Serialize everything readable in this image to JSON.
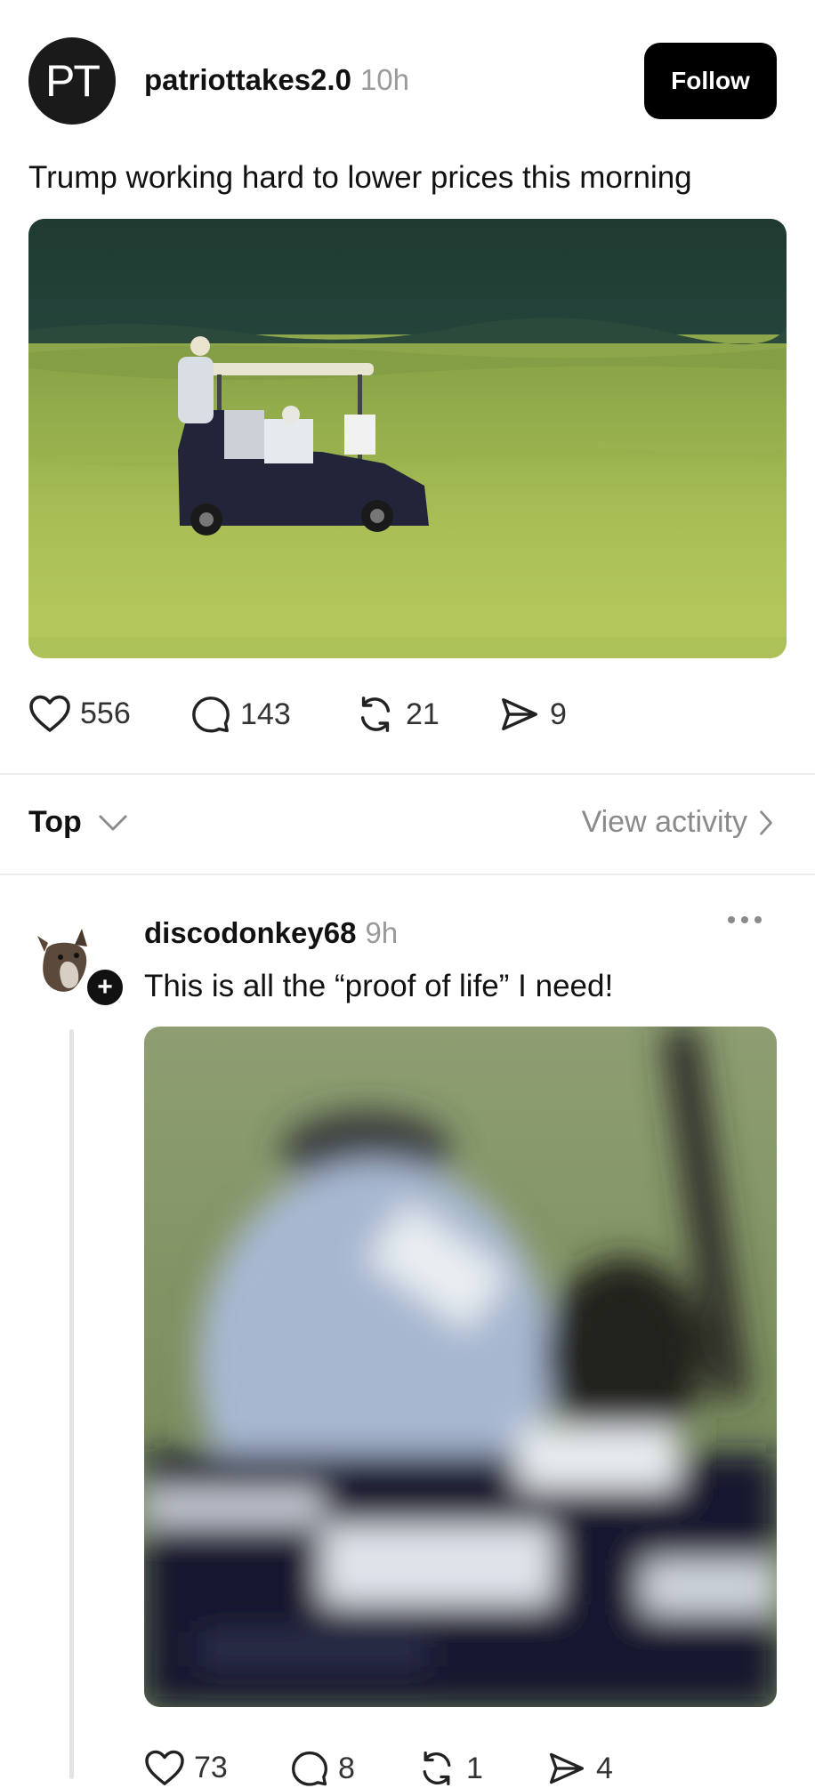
{
  "post": {
    "avatar_text": "PT",
    "username": "patriottakes2.0",
    "time": "10h",
    "follow_label": "Follow",
    "text": "Trump working hard to lower prices this morning",
    "stats": {
      "likes": "556",
      "comments": "143",
      "reposts": "21",
      "shares": "9"
    }
  },
  "sort": {
    "label": "Top",
    "view_activity": "View activity"
  },
  "reply": {
    "username": "discodonkey68",
    "time": "9h",
    "text": "This is all the “proof of life” I need!",
    "stats": {
      "likes": "73",
      "comments": "8",
      "reposts": "1",
      "shares": "4"
    }
  },
  "icons": {
    "like": "heart-icon",
    "comment": "comment-icon",
    "repost": "repost-icon",
    "share": "send-icon",
    "chevron_down": "chevron-down-icon",
    "chevron_right": "chevron-right-icon",
    "more": "more-icon",
    "plus": "plus-icon"
  }
}
